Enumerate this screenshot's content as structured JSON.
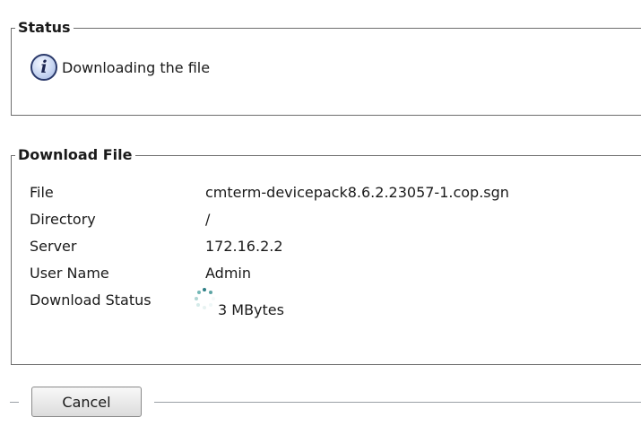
{
  "status": {
    "legend": "Status",
    "icon": "info-icon",
    "icon_glyph": "i",
    "message": "Downloading the file"
  },
  "download": {
    "legend": "Download File",
    "rows": [
      {
        "label": "File",
        "value": "cmterm-devicepack8.6.2.23057-1.cop.sgn"
      },
      {
        "label": "Directory",
        "value": "/"
      },
      {
        "label": "Server",
        "value": "172.16.2.2"
      },
      {
        "label": "User Name",
        "value": "Admin"
      },
      {
        "label": "Download Status",
        "value": "3 MBytes"
      }
    ],
    "spinner_icon": "loading-spinner-icon"
  },
  "actions": {
    "cancel_label": "Cancel"
  },
  "colors": {
    "border": "#6e6e6e",
    "spinner": "#4a9a9a"
  }
}
